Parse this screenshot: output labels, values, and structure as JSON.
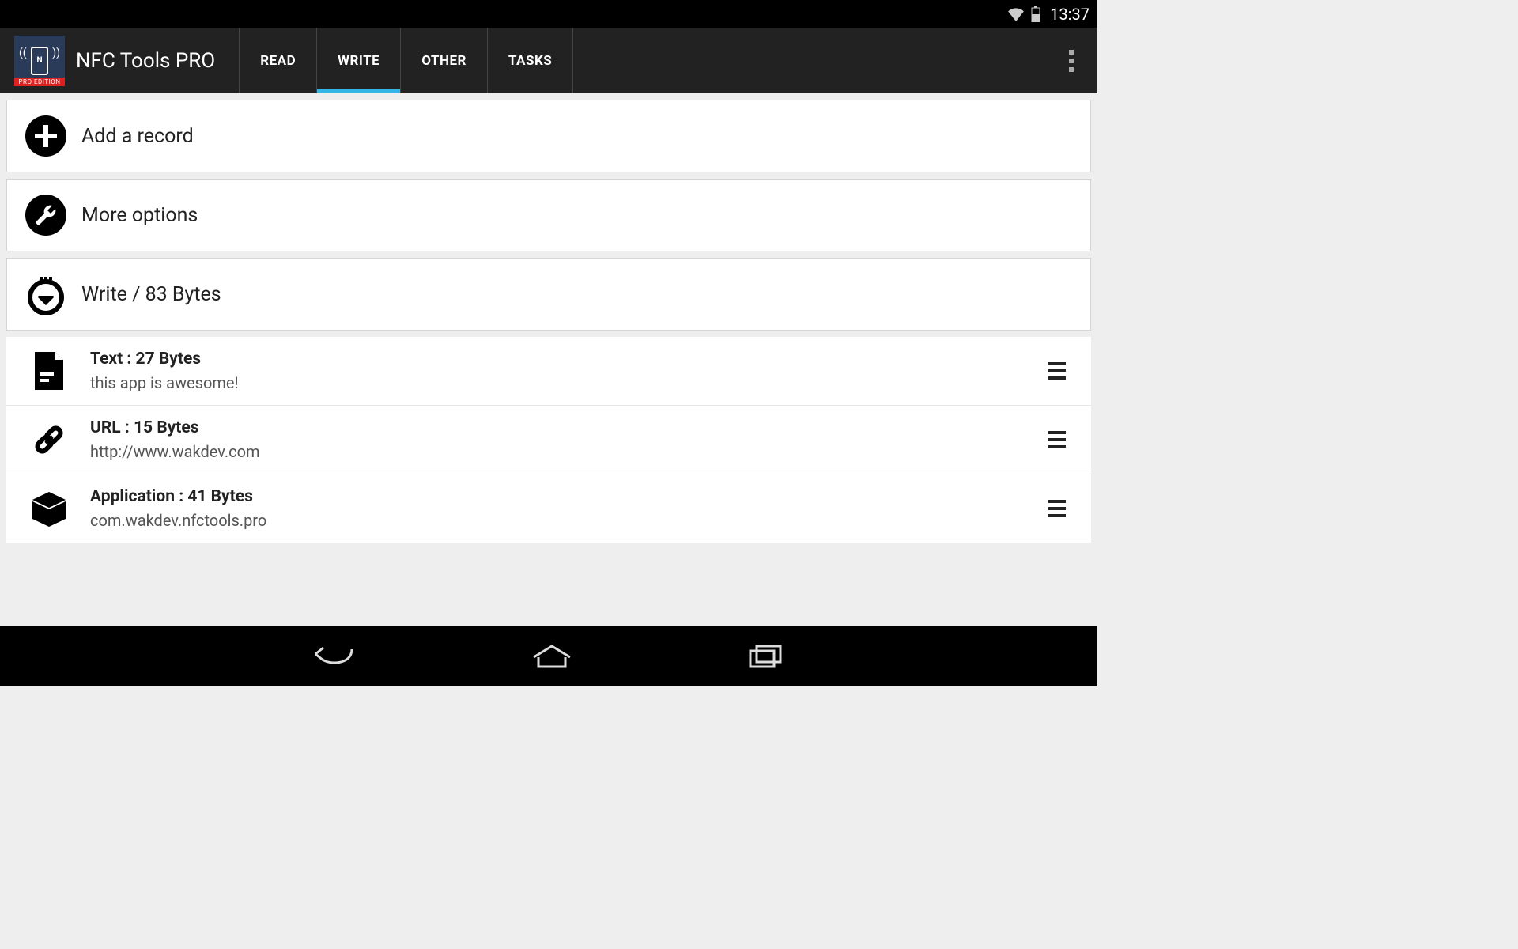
{
  "status": {
    "time": "13:37"
  },
  "app": {
    "title": "NFC Tools PRO",
    "icon_badge": "PRO EDITION"
  },
  "tabs": [
    {
      "label": "READ",
      "active": false
    },
    {
      "label": "WRITE",
      "active": true
    },
    {
      "label": "OTHER",
      "active": false
    },
    {
      "label": "TASKS",
      "active": false
    }
  ],
  "actions": {
    "add_record": "Add a record",
    "more_options": "More options",
    "write_summary": "Write / 83 Bytes"
  },
  "records": [
    {
      "title": "Text : 27 Bytes",
      "subtitle": "this app is awesome!",
      "icon": "document"
    },
    {
      "title": "URL : 15 Bytes",
      "subtitle": "http://www.wakdev.com",
      "icon": "link"
    },
    {
      "title": "Application : 41 Bytes",
      "subtitle": "com.wakdev.nfctools.pro",
      "icon": "package"
    }
  ]
}
